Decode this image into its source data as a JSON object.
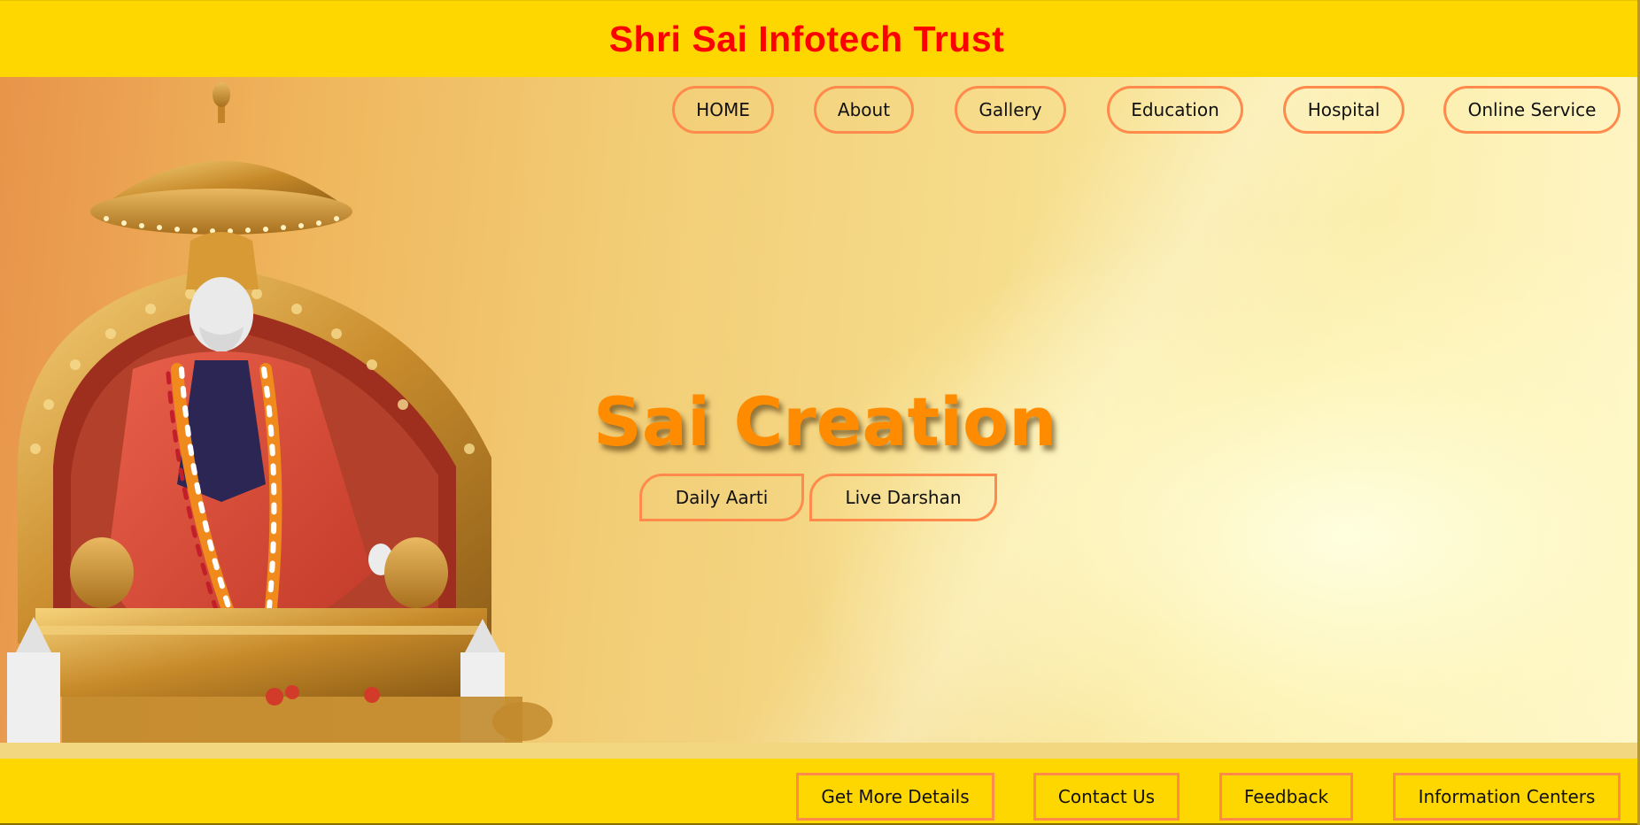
{
  "header": {
    "title": "Shri Sai Infotech Trust"
  },
  "nav": {
    "items": [
      {
        "label": "HOME"
      },
      {
        "label": "About"
      },
      {
        "label": "Gallery"
      },
      {
        "label": "Education"
      },
      {
        "label": "Hospital"
      },
      {
        "label": "Online Service"
      }
    ]
  },
  "hero": {
    "brand": "Sai Creation",
    "buttons": {
      "daily_aarti": "Daily Aarti",
      "live_darshan": "Live Darshan"
    }
  },
  "footer": {
    "buttons": {
      "details": "Get More Details",
      "contact": "Contact Us",
      "feedback": "Feedback",
      "centers": "Information Centers"
    }
  },
  "colors": {
    "header_bg": "#ffd700",
    "title": "#ff0000",
    "brand": "#ff8c00",
    "button_border": "#ff8a4c"
  }
}
